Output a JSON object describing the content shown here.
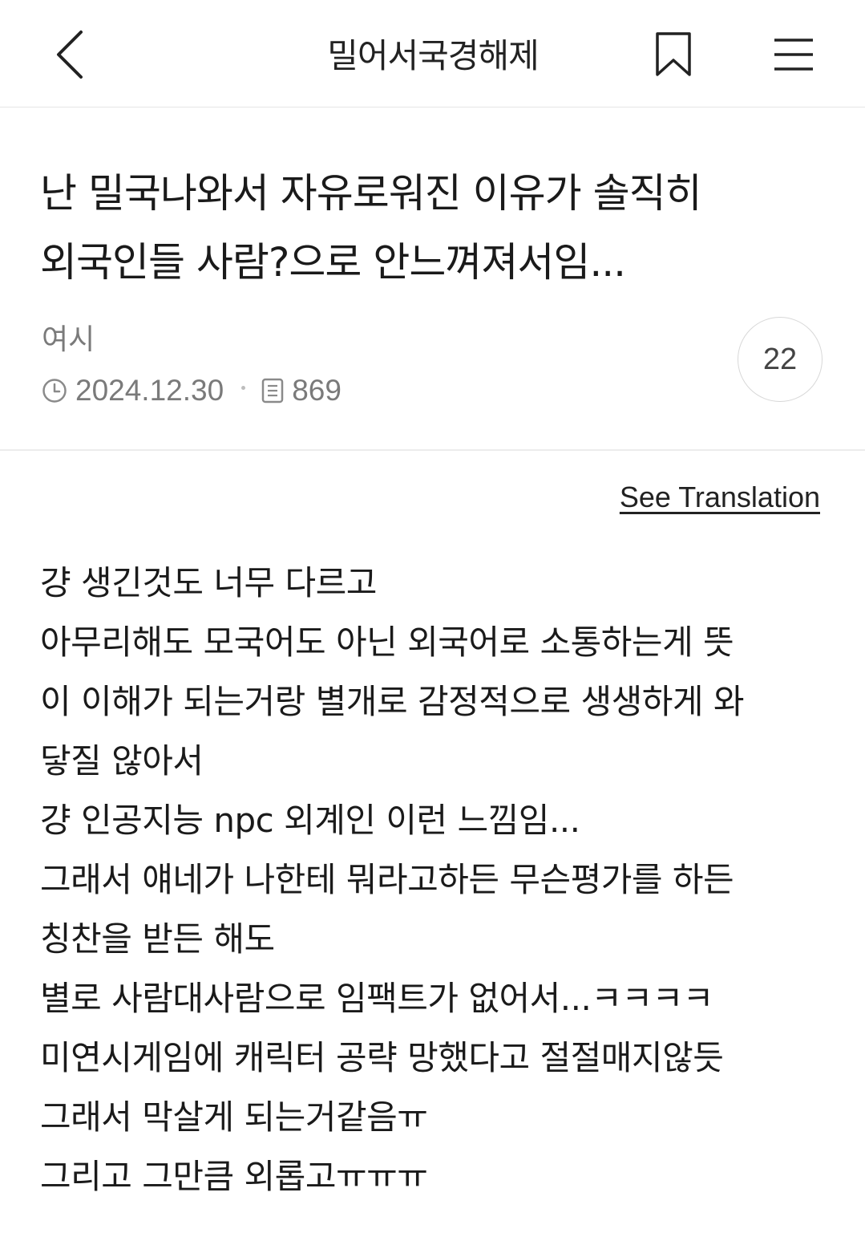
{
  "header": {
    "back_icon": "chevron-left-icon",
    "board_title": "밀어서국경해제",
    "bookmark_icon": "bookmark-icon",
    "menu_icon": "hamburger-menu-icon"
  },
  "post": {
    "title_lines": [
      "난 밀국나와서 자유로워진 이유가 솔직히",
      "외국인들 사람?으로 안느껴져서임..."
    ],
    "author": "여시",
    "date": "2024.12.30",
    "views": "869",
    "comment_count": "22",
    "see_translation": "See Translation",
    "body_lines": [
      "걍 생긴것도 너무 다르고",
      "아무리해도 모국어도 아닌 외국어로 소통하는게 뜻",
      "이 이해가 되는거랑 별개로 감정적으로 생생하게 와",
      "닿질 않아서",
      "걍 인공지능 npc 외계인 이런 느낌임...",
      "그래서 얘네가 나한테 뭐라고하든 무슨평가를 하든",
      "칭찬을 받든 해도",
      "별로 사람대사람으로 임팩트가 없어서...ㅋㅋㅋㅋ",
      "미연시게임에 캐릭터 공략 망했다고 절절매지않듯",
      "그래서 막살게 되는거같음ㅠ",
      "그리고 그만큼 외롭고ㅠㅠㅠ"
    ]
  },
  "colors": {
    "text": "#1a1a1a",
    "muted": "#7a7a7a",
    "divider": "#ececec",
    "circle_border": "#d8d8d8"
  }
}
